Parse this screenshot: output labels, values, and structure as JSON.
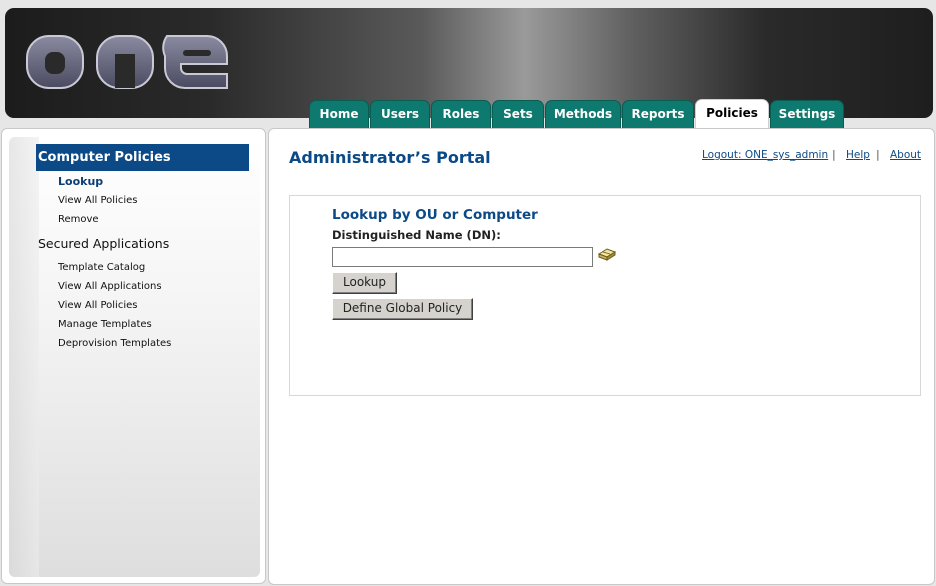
{
  "brand": {
    "logo_text": "ONE"
  },
  "tabs": [
    {
      "label": "Home",
      "active": false
    },
    {
      "label": "Users",
      "active": false
    },
    {
      "label": "Roles",
      "active": false
    },
    {
      "label": "Sets",
      "active": false
    },
    {
      "label": "Methods",
      "active": false
    },
    {
      "label": "Reports",
      "active": false
    },
    {
      "label": "Policies",
      "active": true
    },
    {
      "label": "Settings",
      "active": false
    }
  ],
  "sidebar": {
    "section1_title": "Computer Policies",
    "section1_items": [
      "Lookup",
      "View All Policies",
      "Remove"
    ],
    "section2_title": "Secured Applications",
    "section2_items": [
      "Template Catalog",
      "View All Applications",
      "View All Policies",
      "Manage Templates",
      "Deprovision Templates"
    ]
  },
  "header": {
    "portal_title": "Administrator’s Portal",
    "logout_link": "Logout: ONE_sys_admin",
    "help_link": "Help",
    "about_link": "About",
    "separator": "|"
  },
  "form": {
    "title": "Lookup by OU or Computer",
    "dn_label": "Distinguished Name (DN):",
    "dn_value": "",
    "lookup_button": "Lookup",
    "global_policy_button": "Define Global Policy"
  },
  "colors": {
    "tab_bg": "#0e7a6f",
    "accent_blue": "#0b4a86"
  },
  "icons": {
    "browse": "book-browse-icon"
  }
}
